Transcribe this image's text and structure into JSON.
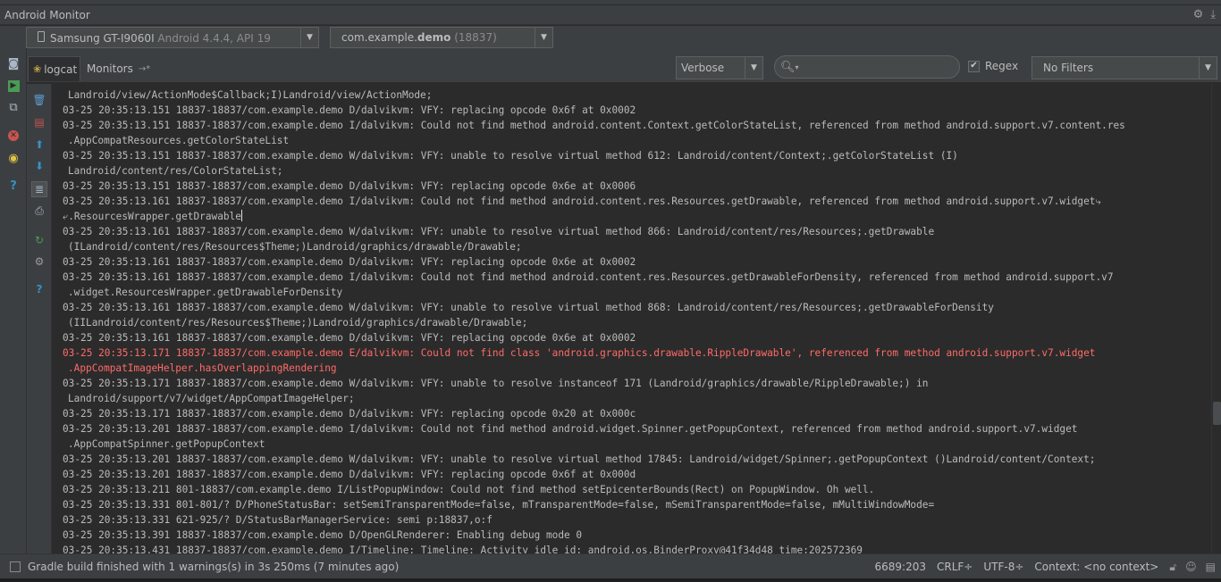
{
  "window": {
    "title": "Android Monitor"
  },
  "device_bar": {
    "device_name": "Samsung GT-I9060I",
    "device_detail": " Android 4.4.4, API 19",
    "process_prefix": "com.example.",
    "process_bold": "demo",
    "process_pid": " (18837)"
  },
  "tabs": {
    "logcat": "logcat",
    "monitors": "Monitors"
  },
  "filters": {
    "log_level": "Verbose",
    "search_placeholder": "",
    "regex_label": "Regex",
    "regex_checked": true,
    "filter_config": "No Filters"
  },
  "log_lines": [
    {
      "level": "V",
      "cont": true,
      "text": "Landroid/view/ActionMode$Callback;I)Landroid/view/ActionMode;"
    },
    {
      "level": "D",
      "cont": false,
      "text": "03-25 20:35:13.151 18837-18837/com.example.demo D/dalvikvm: VFY: replacing opcode 0x6f at 0x0002"
    },
    {
      "level": "I",
      "cont": false,
      "text": "03-25 20:35:13.151 18837-18837/com.example.demo I/dalvikvm: Could not find method android.content.Context.getColorStateList, referenced from method android.support.v7.content.res"
    },
    {
      "level": "I",
      "cont": true,
      "text": ".AppCompatResources.getColorStateList"
    },
    {
      "level": "W",
      "cont": false,
      "text": "03-25 20:35:13.151 18837-18837/com.example.demo W/dalvikvm: VFY: unable to resolve virtual method 612: Landroid/content/Context;.getColorStateList (I)"
    },
    {
      "level": "W",
      "cont": true,
      "text": "Landroid/content/res/ColorStateList;"
    },
    {
      "level": "D",
      "cont": false,
      "text": "03-25 20:35:13.151 18837-18837/com.example.demo D/dalvikvm: VFY: replacing opcode 0x6e at 0x0006"
    },
    {
      "level": "I",
      "cont": false,
      "text": "03-25 20:35:13.161 18837-18837/com.example.demo I/dalvikvm: Could not find method android.content.res.Resources.getDrawable, referenced from method android.support.v7.widget⤷"
    },
    {
      "level": "I",
      "cont": false,
      "caret": true,
      "text": "⤶.ResourcesWrapper.getDrawable"
    },
    {
      "level": "W",
      "cont": false,
      "text": "03-25 20:35:13.161 18837-18837/com.example.demo W/dalvikvm: VFY: unable to resolve virtual method 866: Landroid/content/res/Resources;.getDrawable"
    },
    {
      "level": "W",
      "cont": true,
      "text": "(ILandroid/content/res/Resources$Theme;)Landroid/graphics/drawable/Drawable;"
    },
    {
      "level": "D",
      "cont": false,
      "text": "03-25 20:35:13.161 18837-18837/com.example.demo D/dalvikvm: VFY: replacing opcode 0x6e at 0x0002"
    },
    {
      "level": "I",
      "cont": false,
      "text": "03-25 20:35:13.161 18837-18837/com.example.demo I/dalvikvm: Could not find method android.content.res.Resources.getDrawableForDensity, referenced from method android.support.v7"
    },
    {
      "level": "I",
      "cont": true,
      "text": ".widget.ResourcesWrapper.getDrawableForDensity"
    },
    {
      "level": "W",
      "cont": false,
      "text": "03-25 20:35:13.161 18837-18837/com.example.demo W/dalvikvm: VFY: unable to resolve virtual method 868: Landroid/content/res/Resources;.getDrawableForDensity"
    },
    {
      "level": "W",
      "cont": true,
      "text": "(IILandroid/content/res/Resources$Theme;)Landroid/graphics/drawable/Drawable;"
    },
    {
      "level": "D",
      "cont": false,
      "text": "03-25 20:35:13.161 18837-18837/com.example.demo D/dalvikvm: VFY: replacing opcode 0x6e at 0x0002"
    },
    {
      "level": "E",
      "cont": false,
      "text": "03-25 20:35:13.171 18837-18837/com.example.demo E/dalvikvm: Could not find class 'android.graphics.drawable.RippleDrawable', referenced from method android.support.v7.widget"
    },
    {
      "level": "E",
      "cont": true,
      "text": ".AppCompatImageHelper.hasOverlappingRendering"
    },
    {
      "level": "W",
      "cont": false,
      "text": "03-25 20:35:13.171 18837-18837/com.example.demo W/dalvikvm: VFY: unable to resolve instanceof 171 (Landroid/graphics/drawable/RippleDrawable;) in"
    },
    {
      "level": "W",
      "cont": true,
      "text": "Landroid/support/v7/widget/AppCompatImageHelper;"
    },
    {
      "level": "D",
      "cont": false,
      "text": "03-25 20:35:13.171 18837-18837/com.example.demo D/dalvikvm: VFY: replacing opcode 0x20 at 0x000c"
    },
    {
      "level": "I",
      "cont": false,
      "text": "03-25 20:35:13.201 18837-18837/com.example.demo I/dalvikvm: Could not find method android.widget.Spinner.getPopupContext, referenced from method android.support.v7.widget"
    },
    {
      "level": "I",
      "cont": true,
      "text": ".AppCompatSpinner.getPopupContext"
    },
    {
      "level": "W",
      "cont": false,
      "text": "03-25 20:35:13.201 18837-18837/com.example.demo W/dalvikvm: VFY: unable to resolve virtual method 17845: Landroid/widget/Spinner;.getPopupContext ()Landroid/content/Context;"
    },
    {
      "level": "D",
      "cont": false,
      "text": "03-25 20:35:13.201 18837-18837/com.example.demo D/dalvikvm: VFY: replacing opcode 0x6f at 0x000d"
    },
    {
      "level": "I",
      "cont": false,
      "text": "03-25 20:35:13.211 801-18837/com.example.demo I/ListPopupWindow: Could not find method setEpicenterBounds(Rect) on PopupWindow. Oh well."
    },
    {
      "level": "D",
      "cont": false,
      "text": "03-25 20:35:13.331 801-801/? D/PhoneStatusBar: setSemiTransparentMode=false, mTransparentMode=false, mSemiTransparentMode=false, mMultiWindowMode="
    },
    {
      "level": "D",
      "cont": false,
      "text": "03-25 20:35:13.331 621-925/? D/StatusBarManagerService: semi p:18837,o:f"
    },
    {
      "level": "D",
      "cont": false,
      "text": "03-25 20:35:13.391 18837-18837/com.example.demo D/OpenGLRenderer: Enabling debug mode 0"
    },
    {
      "level": "I",
      "cont": false,
      "text": "03-25 20:35:13.431 18837-18837/com.example.demo I/Timeline: Timeline: Activity_idle id: android.os.BinderProxy@41f34d48 time:202572369"
    }
  ],
  "status_bar": {
    "message": "Gradle build finished with 1 warnings(s) in 3s 250ms (7 minutes ago)",
    "position": "6689:203",
    "line_sep": "CRLF÷",
    "encoding": "UTF-8÷",
    "context": "Context: <no context>"
  },
  "colors": {
    "background": "#2b2b2b",
    "panel": "#3c3f41",
    "text": "#bbbbbb",
    "error": "#ff6b68"
  }
}
